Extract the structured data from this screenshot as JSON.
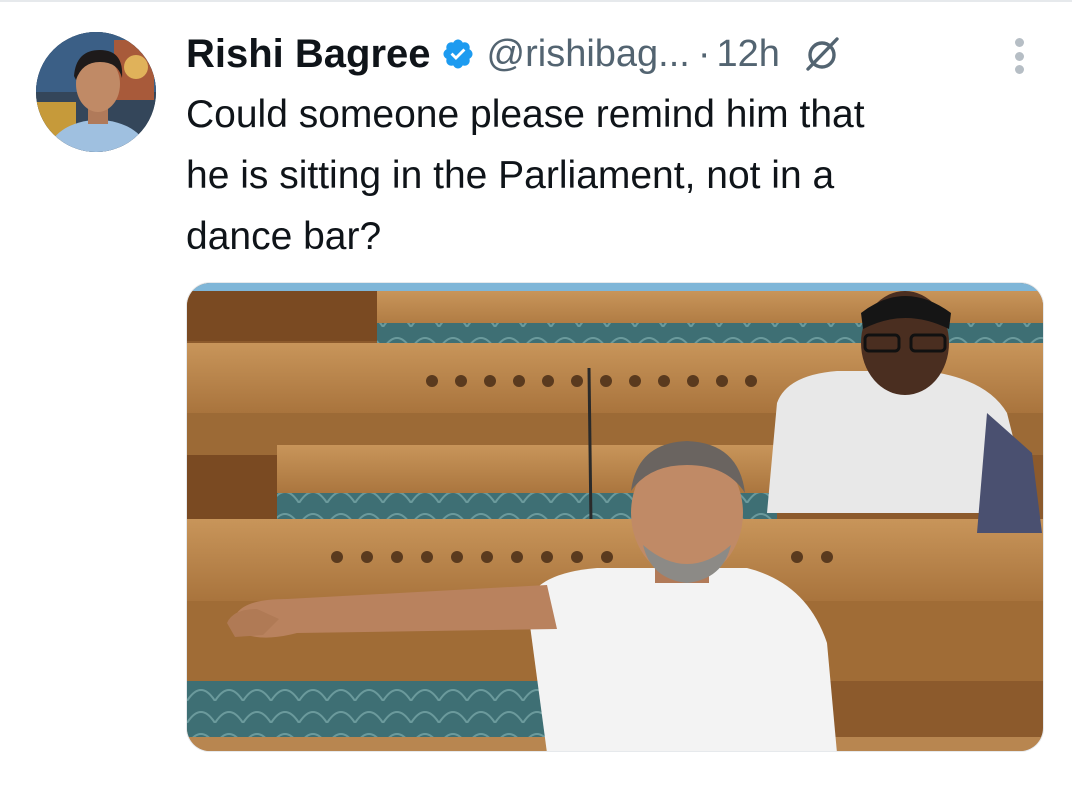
{
  "tweet": {
    "author_name": "Rishi Bagree",
    "handle": "@rishibag...",
    "separator": "·",
    "time": "12h",
    "text_lines": [
      "Could someone please remind him that",
      "he is sitting in the Parliament, not in a",
      "dance bar?"
    ]
  },
  "icons": {
    "verified": "verified-badge-icon",
    "grok": "grok-icon",
    "more": "more-options-icon"
  },
  "colors": {
    "text_primary": "#0f1419",
    "text_secondary": "#536471",
    "verified_blue": "#1d9bf0",
    "bench_wood": "#b98245",
    "carpet_teal": "#3e6f74"
  }
}
